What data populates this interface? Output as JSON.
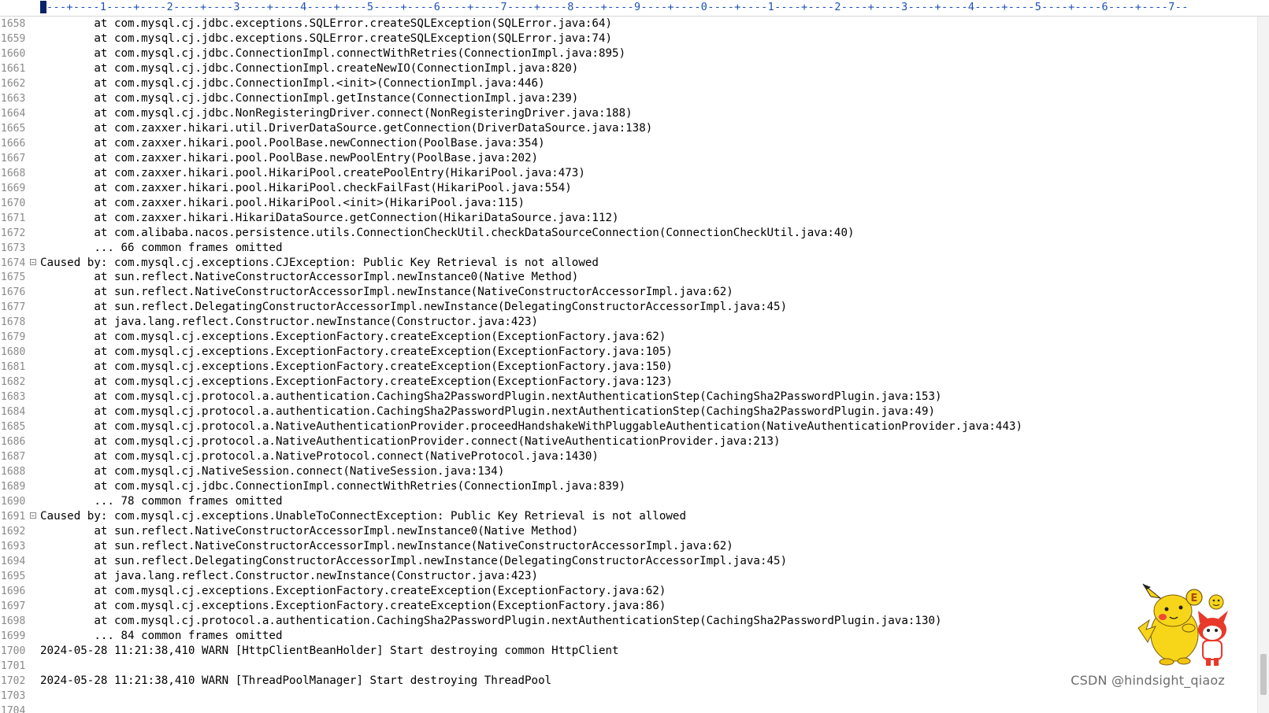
{
  "ruler": {
    "text": "---+----1----+----2----+----3----+----4----+----5----+----6----+----7----+----8----+----9----+----0----+----1----+----2----+----3----+----4----+----5----+----6----+----7--"
  },
  "editor": {
    "lines": [
      {
        "n": "1658",
        "text": "        at com.mysql.cj.jdbc.exceptions.SQLError.createSQLException(SQLError.java:64)",
        "fold": false
      },
      {
        "n": "1659",
        "text": "        at com.mysql.cj.jdbc.exceptions.SQLError.createSQLException(SQLError.java:74)",
        "fold": false
      },
      {
        "n": "1660",
        "text": "        at com.mysql.cj.jdbc.ConnectionImpl.connectWithRetries(ConnectionImpl.java:895)",
        "fold": false
      },
      {
        "n": "1661",
        "text": "        at com.mysql.cj.jdbc.ConnectionImpl.createNewIO(ConnectionImpl.java:820)",
        "fold": false
      },
      {
        "n": "1662",
        "text": "        at com.mysql.cj.jdbc.ConnectionImpl.<init>(ConnectionImpl.java:446)",
        "fold": false
      },
      {
        "n": "1663",
        "text": "        at com.mysql.cj.jdbc.ConnectionImpl.getInstance(ConnectionImpl.java:239)",
        "fold": false
      },
      {
        "n": "1664",
        "text": "        at com.mysql.cj.jdbc.NonRegisteringDriver.connect(NonRegisteringDriver.java:188)",
        "fold": false
      },
      {
        "n": "1665",
        "text": "        at com.zaxxer.hikari.util.DriverDataSource.getConnection(DriverDataSource.java:138)",
        "fold": false
      },
      {
        "n": "1666",
        "text": "        at com.zaxxer.hikari.pool.PoolBase.newConnection(PoolBase.java:354)",
        "fold": false
      },
      {
        "n": "1667",
        "text": "        at com.zaxxer.hikari.pool.PoolBase.newPoolEntry(PoolBase.java:202)",
        "fold": false
      },
      {
        "n": "1668",
        "text": "        at com.zaxxer.hikari.pool.HikariPool.createPoolEntry(HikariPool.java:473)",
        "fold": false
      },
      {
        "n": "1669",
        "text": "        at com.zaxxer.hikari.pool.HikariPool.checkFailFast(HikariPool.java:554)",
        "fold": false
      },
      {
        "n": "1670",
        "text": "        at com.zaxxer.hikari.pool.HikariPool.<init>(HikariPool.java:115)",
        "fold": false
      },
      {
        "n": "1671",
        "text": "        at com.zaxxer.hikari.HikariDataSource.getConnection(HikariDataSource.java:112)",
        "fold": false
      },
      {
        "n": "1672",
        "text": "        at com.alibaba.nacos.persistence.utils.ConnectionCheckUtil.checkDataSourceConnection(ConnectionCheckUtil.java:40)",
        "fold": false
      },
      {
        "n": "1673",
        "text": "        ... 66 common frames omitted",
        "fold": false
      },
      {
        "n": "1674",
        "text": "Caused by: com.mysql.cj.exceptions.CJException: Public Key Retrieval is not allowed",
        "fold": true
      },
      {
        "n": "1675",
        "text": "        at sun.reflect.NativeConstructorAccessorImpl.newInstance0(Native Method)",
        "fold": false
      },
      {
        "n": "1676",
        "text": "        at sun.reflect.NativeConstructorAccessorImpl.newInstance(NativeConstructorAccessorImpl.java:62)",
        "fold": false
      },
      {
        "n": "1677",
        "text": "        at sun.reflect.DelegatingConstructorAccessorImpl.newInstance(DelegatingConstructorAccessorImpl.java:45)",
        "fold": false
      },
      {
        "n": "1678",
        "text": "        at java.lang.reflect.Constructor.newInstance(Constructor.java:423)",
        "fold": false
      },
      {
        "n": "1679",
        "text": "        at com.mysql.cj.exceptions.ExceptionFactory.createException(ExceptionFactory.java:62)",
        "fold": false
      },
      {
        "n": "1680",
        "text": "        at com.mysql.cj.exceptions.ExceptionFactory.createException(ExceptionFactory.java:105)",
        "fold": false
      },
      {
        "n": "1681",
        "text": "        at com.mysql.cj.exceptions.ExceptionFactory.createException(ExceptionFactory.java:150)",
        "fold": false
      },
      {
        "n": "1682",
        "text": "        at com.mysql.cj.exceptions.ExceptionFactory.createException(ExceptionFactory.java:123)",
        "fold": false
      },
      {
        "n": "1683",
        "text": "        at com.mysql.cj.protocol.a.authentication.CachingSha2PasswordPlugin.nextAuthenticationStep(CachingSha2PasswordPlugin.java:153)",
        "fold": false
      },
      {
        "n": "1684",
        "text": "        at com.mysql.cj.protocol.a.authentication.CachingSha2PasswordPlugin.nextAuthenticationStep(CachingSha2PasswordPlugin.java:49)",
        "fold": false
      },
      {
        "n": "1685",
        "text": "        at com.mysql.cj.protocol.a.NativeAuthenticationProvider.proceedHandshakeWithPluggableAuthentication(NativeAuthenticationProvider.java:443)",
        "fold": false
      },
      {
        "n": "1686",
        "text": "        at com.mysql.cj.protocol.a.NativeAuthenticationProvider.connect(NativeAuthenticationProvider.java:213)",
        "fold": false
      },
      {
        "n": "1687",
        "text": "        at com.mysql.cj.protocol.a.NativeProtocol.connect(NativeProtocol.java:1430)",
        "fold": false
      },
      {
        "n": "1688",
        "text": "        at com.mysql.cj.NativeSession.connect(NativeSession.java:134)",
        "fold": false
      },
      {
        "n": "1689",
        "text": "        at com.mysql.cj.jdbc.ConnectionImpl.connectWithRetries(ConnectionImpl.java:839)",
        "fold": false
      },
      {
        "n": "1690",
        "text": "        ... 78 common frames omitted",
        "fold": false
      },
      {
        "n": "1691",
        "text": "Caused by: com.mysql.cj.exceptions.UnableToConnectException: Public Key Retrieval is not allowed",
        "fold": true
      },
      {
        "n": "1692",
        "text": "        at sun.reflect.NativeConstructorAccessorImpl.newInstance0(Native Method)",
        "fold": false
      },
      {
        "n": "1693",
        "text": "        at sun.reflect.NativeConstructorAccessorImpl.newInstance(NativeConstructorAccessorImpl.java:62)",
        "fold": false
      },
      {
        "n": "1694",
        "text": "        at sun.reflect.DelegatingConstructorAccessorImpl.newInstance(DelegatingConstructorAccessorImpl.java:45)",
        "fold": false
      },
      {
        "n": "1695",
        "text": "        at java.lang.reflect.Constructor.newInstance(Constructor.java:423)",
        "fold": false
      },
      {
        "n": "1696",
        "text": "        at com.mysql.cj.exceptions.ExceptionFactory.createException(ExceptionFactory.java:62)",
        "fold": false
      },
      {
        "n": "1697",
        "text": "        at com.mysql.cj.exceptions.ExceptionFactory.createException(ExceptionFactory.java:86)",
        "fold": false
      },
      {
        "n": "1698",
        "text": "        at com.mysql.cj.protocol.a.authentication.CachingSha2PasswordPlugin.nextAuthenticationStep(CachingSha2PasswordPlugin.java:130)",
        "fold": false
      },
      {
        "n": "1699",
        "text": "        ... 84 common frames omitted",
        "fold": false
      },
      {
        "n": "1700",
        "text": "2024-05-28 11:21:38,410 WARN [HttpClientBeanHolder] Start destroying common HttpClient",
        "fold": false
      },
      {
        "n": "1701",
        "text": "",
        "fold": false
      },
      {
        "n": "1702",
        "text": "2024-05-28 11:21:38,410 WARN [ThreadPoolManager] Start destroying ThreadPool",
        "fold": false
      },
      {
        "n": "1703",
        "text": "",
        "fold": false
      },
      {
        "n": "1704",
        "text": "",
        "fold": false
      }
    ]
  },
  "watermark": {
    "text": "CSDN @hindsight_qiaoz"
  },
  "mascot": {
    "icon": "pikachu-sticker-icon",
    "badge_letter": "E"
  },
  "colors": {
    "line_number": "#8a8a8a",
    "ruler_text": "#1e4fb4",
    "text": "#000000",
    "mascot_yellow": "#f7d61a",
    "mascot_red": "#e8392a"
  }
}
